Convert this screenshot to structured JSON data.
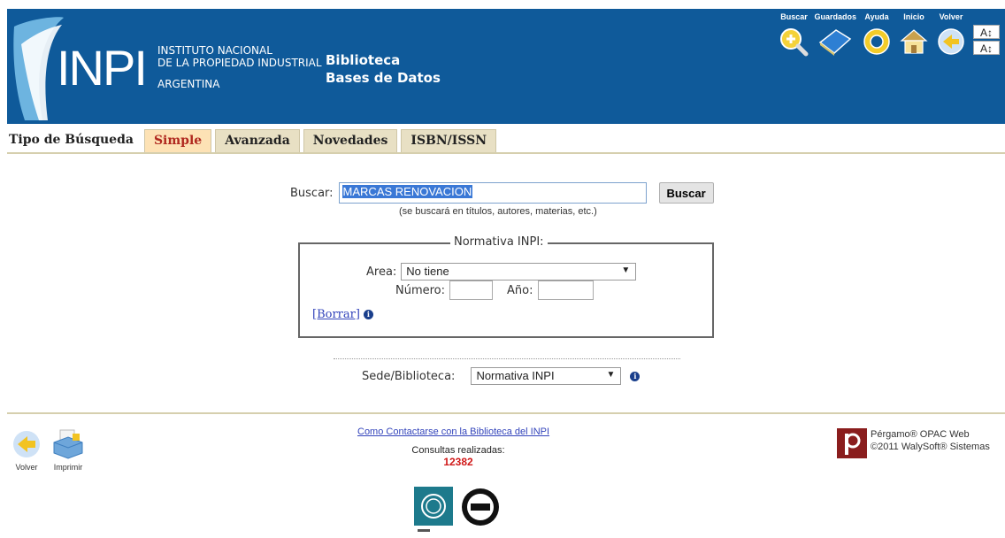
{
  "header": {
    "logo_text": "INPI",
    "institution_line1": "INSTITUTO NACIONAL",
    "institution_line2": "DE LA PROPIEDAD INDUSTRIAL",
    "country": "ARGENTINA",
    "section_line1": "Biblioteca",
    "section_line2": "Bases de Datos",
    "nav": [
      {
        "label": "Buscar",
        "icon": "magnifier-plus-icon"
      },
      {
        "label": "Guardados",
        "icon": "book-icon"
      },
      {
        "label": "Ayuda",
        "icon": "lifebuoy-icon"
      },
      {
        "label": "Inicio",
        "icon": "house-icon"
      },
      {
        "label": "Volver",
        "icon": "arrow-left-icon"
      }
    ],
    "font_up": "A↕",
    "font_down": "A↕"
  },
  "tabs": {
    "title": "Tipo de Búsqueda",
    "items": [
      {
        "label": "Simple",
        "active": true
      },
      {
        "label": "Avanzada",
        "active": false
      },
      {
        "label": "Novedades",
        "active": false
      },
      {
        "label": "ISBN/ISSN",
        "active": false
      }
    ]
  },
  "search": {
    "label": "Buscar:",
    "value": "MARCAS RENOVACION",
    "button": "Buscar",
    "hint": "(se buscará en títulos, autores, materias, etc.)"
  },
  "normativa": {
    "legend": "Normativa INPI:",
    "area_label": "Area:",
    "area_value": "No tiene",
    "numero_label": "Número:",
    "numero_value": "",
    "anio_label": "Año:",
    "anio_value": "",
    "clear_link": "[Borrar]"
  },
  "sede": {
    "label": "Sede/Biblioteca:",
    "value": "Normativa INPI"
  },
  "footer": {
    "back_label": "Volver",
    "print_label": "Imprimir",
    "contact_link": "Como Contactarse con la Biblioteca del INPI",
    "queries_label": "Consultas realizadas:",
    "queries_count": "12382",
    "brand_line1": "Pérgamo® OPAC Web",
    "brand_line2": "©2011 WalySoft® Sistemas"
  },
  "colors": {
    "header_bg": "#0f5a9a",
    "active_tab_bg": "#fde2b5",
    "tab_bg": "#e8e0c4",
    "link": "#3344bb",
    "count": "#d01818"
  }
}
